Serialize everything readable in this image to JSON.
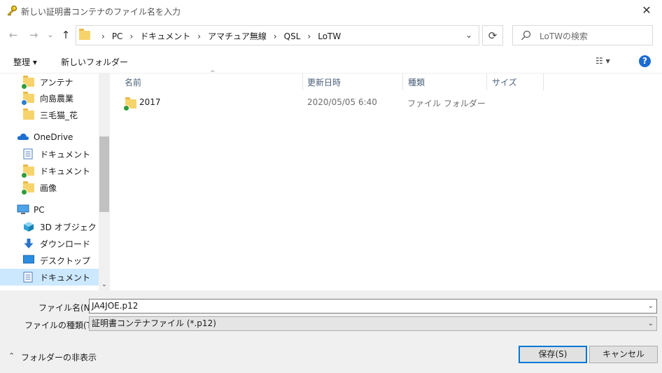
{
  "window": {
    "title": "新しい証明書コンテナのファイル名を入力",
    "close_glyph": "✕"
  },
  "nav": {
    "back_glyph": "←",
    "forward_glyph": "→",
    "recent_glyph": "⌄",
    "up_glyph": "↑",
    "breadcrumb": [
      "PC",
      "ドキュメント",
      "アマチュア無線",
      "QSL",
      "LoTW"
    ],
    "sep": "›",
    "dropdown_glyph": "⌄",
    "refresh_glyph": "⟳"
  },
  "search": {
    "placeholder": "LoTWの検索"
  },
  "toolbar": {
    "organize_label": "整理 ▾",
    "new_folder_label": "新しいフォルダー",
    "view_glyph": "☷ ▾",
    "help_label": "?"
  },
  "sidebar": {
    "items": [
      {
        "label": "アンテナ",
        "icon": "folder-synced-icon"
      },
      {
        "label": "向島農業",
        "icon": "folder-syncing-icon"
      },
      {
        "label": "三毛猫_花",
        "icon": "folder-icon"
      },
      {
        "label": "OneDrive",
        "icon": "cloud-icon"
      },
      {
        "label": "ドキュメント",
        "icon": "document-icon"
      },
      {
        "label": "ドキュメント",
        "icon": "folder-synced-icon"
      },
      {
        "label": "画像",
        "icon": "folder-synced-icon"
      },
      {
        "label": "PC",
        "icon": "computer-icon"
      },
      {
        "label": "3D オブジェクト",
        "icon": "cube-icon"
      },
      {
        "label": "ダウンロード",
        "icon": "download-icon"
      },
      {
        "label": "デスクトップ",
        "icon": "desktop-icon"
      },
      {
        "label": "ドキュメント",
        "icon": "document-icon"
      }
    ],
    "scroll_down_glyph": "⌄"
  },
  "columns": {
    "name": "名前",
    "modified": "更新日時",
    "type": "種類",
    "size": "サイズ",
    "sort_glyph": "^"
  },
  "files": [
    {
      "name": "2017",
      "modified": "2020/05/05 6:40",
      "type": "ファイル フォルダー",
      "size": ""
    }
  ],
  "form": {
    "filename_label": "ファイル名(N):",
    "filename_value": "JA4JOE.p12",
    "filetype_label": "ファイルの種類(T):",
    "filetype_value": "証明書コンテナファイル (*.p12)",
    "arrow_glyph": "⌄"
  },
  "footer": {
    "hide_folders_label": "フォルダーの非表示",
    "hide_glyph": "⌃",
    "save_label": "保存(S)",
    "cancel_label": "キャンセル"
  },
  "colors": {
    "accent": "#0078d7",
    "selection": "#cce8ff",
    "help": "#1c6bd0"
  }
}
